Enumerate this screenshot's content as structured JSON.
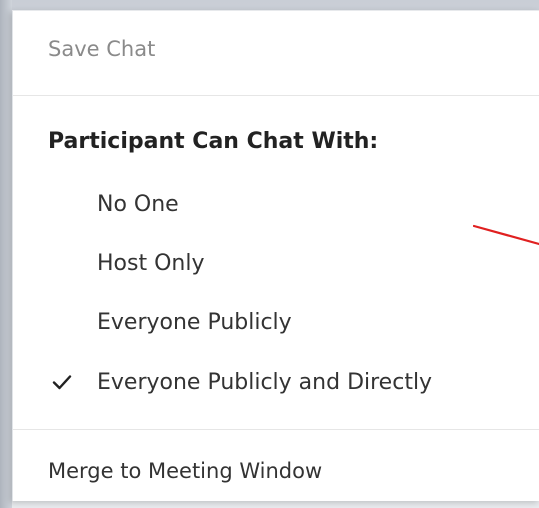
{
  "menu": {
    "save_chat": "Save Chat",
    "section_title": "Participant Can Chat With:",
    "options": [
      {
        "label": "No One",
        "checked": false
      },
      {
        "label": "Host Only",
        "checked": false
      },
      {
        "label": "Everyone Publicly",
        "checked": false
      },
      {
        "label": "Everyone Publicly and Directly",
        "checked": true
      }
    ],
    "merge": "Merge to Meeting Window"
  },
  "icons": {
    "check": "checkmark-icon"
  },
  "colors": {
    "annotation_arrow": "#e02020",
    "disabled_text": "#8a8a8a",
    "menu_text": "#333333"
  }
}
